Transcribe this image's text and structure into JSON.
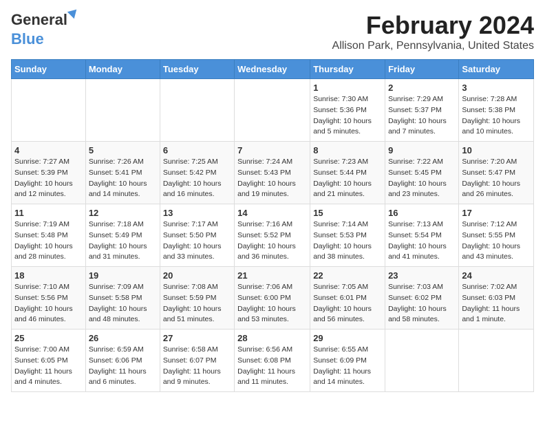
{
  "logo": {
    "line1": "General",
    "line2": "Blue"
  },
  "title": "February 2024",
  "subtitle": "Allison Park, Pennsylvania, United States",
  "days_of_week": [
    "Sunday",
    "Monday",
    "Tuesday",
    "Wednesday",
    "Thursday",
    "Friday",
    "Saturday"
  ],
  "weeks": [
    [
      {
        "num": "",
        "detail": ""
      },
      {
        "num": "",
        "detail": ""
      },
      {
        "num": "",
        "detail": ""
      },
      {
        "num": "",
        "detail": ""
      },
      {
        "num": "1",
        "detail": "Sunrise: 7:30 AM\nSunset: 5:36 PM\nDaylight: 10 hours\nand 5 minutes."
      },
      {
        "num": "2",
        "detail": "Sunrise: 7:29 AM\nSunset: 5:37 PM\nDaylight: 10 hours\nand 7 minutes."
      },
      {
        "num": "3",
        "detail": "Sunrise: 7:28 AM\nSunset: 5:38 PM\nDaylight: 10 hours\nand 10 minutes."
      }
    ],
    [
      {
        "num": "4",
        "detail": "Sunrise: 7:27 AM\nSunset: 5:39 PM\nDaylight: 10 hours\nand 12 minutes."
      },
      {
        "num": "5",
        "detail": "Sunrise: 7:26 AM\nSunset: 5:41 PM\nDaylight: 10 hours\nand 14 minutes."
      },
      {
        "num": "6",
        "detail": "Sunrise: 7:25 AM\nSunset: 5:42 PM\nDaylight: 10 hours\nand 16 minutes."
      },
      {
        "num": "7",
        "detail": "Sunrise: 7:24 AM\nSunset: 5:43 PM\nDaylight: 10 hours\nand 19 minutes."
      },
      {
        "num": "8",
        "detail": "Sunrise: 7:23 AM\nSunset: 5:44 PM\nDaylight: 10 hours\nand 21 minutes."
      },
      {
        "num": "9",
        "detail": "Sunrise: 7:22 AM\nSunset: 5:45 PM\nDaylight: 10 hours\nand 23 minutes."
      },
      {
        "num": "10",
        "detail": "Sunrise: 7:20 AM\nSunset: 5:47 PM\nDaylight: 10 hours\nand 26 minutes."
      }
    ],
    [
      {
        "num": "11",
        "detail": "Sunrise: 7:19 AM\nSunset: 5:48 PM\nDaylight: 10 hours\nand 28 minutes."
      },
      {
        "num": "12",
        "detail": "Sunrise: 7:18 AM\nSunset: 5:49 PM\nDaylight: 10 hours\nand 31 minutes."
      },
      {
        "num": "13",
        "detail": "Sunrise: 7:17 AM\nSunset: 5:50 PM\nDaylight: 10 hours\nand 33 minutes."
      },
      {
        "num": "14",
        "detail": "Sunrise: 7:16 AM\nSunset: 5:52 PM\nDaylight: 10 hours\nand 36 minutes."
      },
      {
        "num": "15",
        "detail": "Sunrise: 7:14 AM\nSunset: 5:53 PM\nDaylight: 10 hours\nand 38 minutes."
      },
      {
        "num": "16",
        "detail": "Sunrise: 7:13 AM\nSunset: 5:54 PM\nDaylight: 10 hours\nand 41 minutes."
      },
      {
        "num": "17",
        "detail": "Sunrise: 7:12 AM\nSunset: 5:55 PM\nDaylight: 10 hours\nand 43 minutes."
      }
    ],
    [
      {
        "num": "18",
        "detail": "Sunrise: 7:10 AM\nSunset: 5:56 PM\nDaylight: 10 hours\nand 46 minutes."
      },
      {
        "num": "19",
        "detail": "Sunrise: 7:09 AM\nSunset: 5:58 PM\nDaylight: 10 hours\nand 48 minutes."
      },
      {
        "num": "20",
        "detail": "Sunrise: 7:08 AM\nSunset: 5:59 PM\nDaylight: 10 hours\nand 51 minutes."
      },
      {
        "num": "21",
        "detail": "Sunrise: 7:06 AM\nSunset: 6:00 PM\nDaylight: 10 hours\nand 53 minutes."
      },
      {
        "num": "22",
        "detail": "Sunrise: 7:05 AM\nSunset: 6:01 PM\nDaylight: 10 hours\nand 56 minutes."
      },
      {
        "num": "23",
        "detail": "Sunrise: 7:03 AM\nSunset: 6:02 PM\nDaylight: 10 hours\nand 58 minutes."
      },
      {
        "num": "24",
        "detail": "Sunrise: 7:02 AM\nSunset: 6:03 PM\nDaylight: 11 hours\nand 1 minute."
      }
    ],
    [
      {
        "num": "25",
        "detail": "Sunrise: 7:00 AM\nSunset: 6:05 PM\nDaylight: 11 hours\nand 4 minutes."
      },
      {
        "num": "26",
        "detail": "Sunrise: 6:59 AM\nSunset: 6:06 PM\nDaylight: 11 hours\nand 6 minutes."
      },
      {
        "num": "27",
        "detail": "Sunrise: 6:58 AM\nSunset: 6:07 PM\nDaylight: 11 hours\nand 9 minutes."
      },
      {
        "num": "28",
        "detail": "Sunrise: 6:56 AM\nSunset: 6:08 PM\nDaylight: 11 hours\nand 11 minutes."
      },
      {
        "num": "29",
        "detail": "Sunrise: 6:55 AM\nSunset: 6:09 PM\nDaylight: 11 hours\nand 14 minutes."
      },
      {
        "num": "",
        "detail": ""
      },
      {
        "num": "",
        "detail": ""
      }
    ]
  ]
}
